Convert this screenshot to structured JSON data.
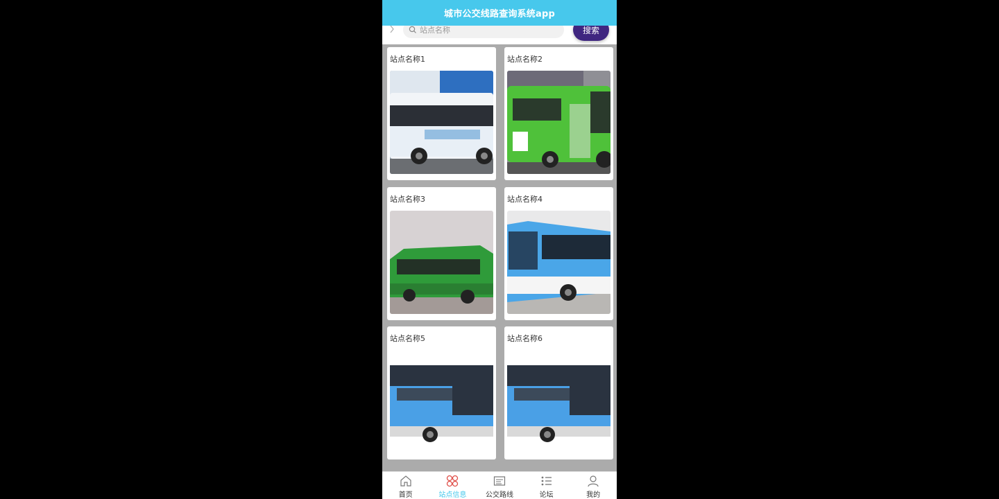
{
  "app": {
    "title": "城市公交线路查询系统app"
  },
  "search": {
    "placeholder": "站点名称",
    "button_label": "搜索"
  },
  "stations": [
    {
      "name": "站点名称1",
      "image": "bus-photo-white-blue-ad"
    },
    {
      "name": "站点名称2",
      "image": "bus-photo-green-25"
    },
    {
      "name": "站点名称3",
      "image": "bus-photo-green"
    },
    {
      "name": "站点名称4",
      "image": "bus-photo-blue"
    },
    {
      "name": "站点名称5",
      "image": "bus-photo-blue-white"
    },
    {
      "name": "站点名称6",
      "image": "bus-photo-blue-white"
    }
  ],
  "tabs": [
    {
      "label": "首页",
      "icon": "home-icon",
      "active": false
    },
    {
      "label": "站点信息",
      "icon": "station-icon",
      "active": true
    },
    {
      "label": "公交路线",
      "icon": "route-icon",
      "active": false
    },
    {
      "label": "论坛",
      "icon": "forum-icon",
      "active": false
    },
    {
      "label": "我的",
      "icon": "user-icon",
      "active": false
    }
  ],
  "colors": {
    "header": "#47c8ec",
    "search_button": "#3f2680",
    "active_tab": "#47c8ec",
    "active_tab_icon": "#e0504a",
    "grid_background": "#ababab"
  }
}
